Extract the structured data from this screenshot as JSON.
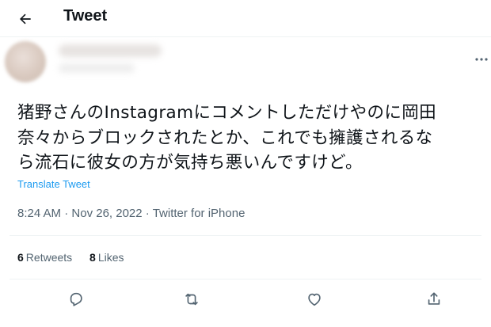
{
  "header": {
    "title": "Tweet"
  },
  "tweet": {
    "text": "猪野さんのInstagramにコメントしただけやのに岡田\n奈々からブロックされたとか、これでも擁護されるな\nら流石に彼女の方が気持ち悪いんですけど。",
    "translate_label": "Translate Tweet",
    "time": "8:24 AM",
    "date": "Nov 26, 2022",
    "source": "Twitter for iPhone",
    "separator": "·"
  },
  "stats": {
    "retweets_count": "6",
    "retweets_label": "Retweets",
    "likes_count": "8",
    "likes_label": "Likes"
  },
  "icons": {
    "back": "arrow-left-icon",
    "more": "more-dots-icon",
    "reply": "reply-icon",
    "retweet": "retweet-icon",
    "like": "heart-icon",
    "share": "share-icon"
  },
  "colors": {
    "link": "#1d9bf0",
    "muted": "#536471",
    "text": "#0f1419"
  }
}
